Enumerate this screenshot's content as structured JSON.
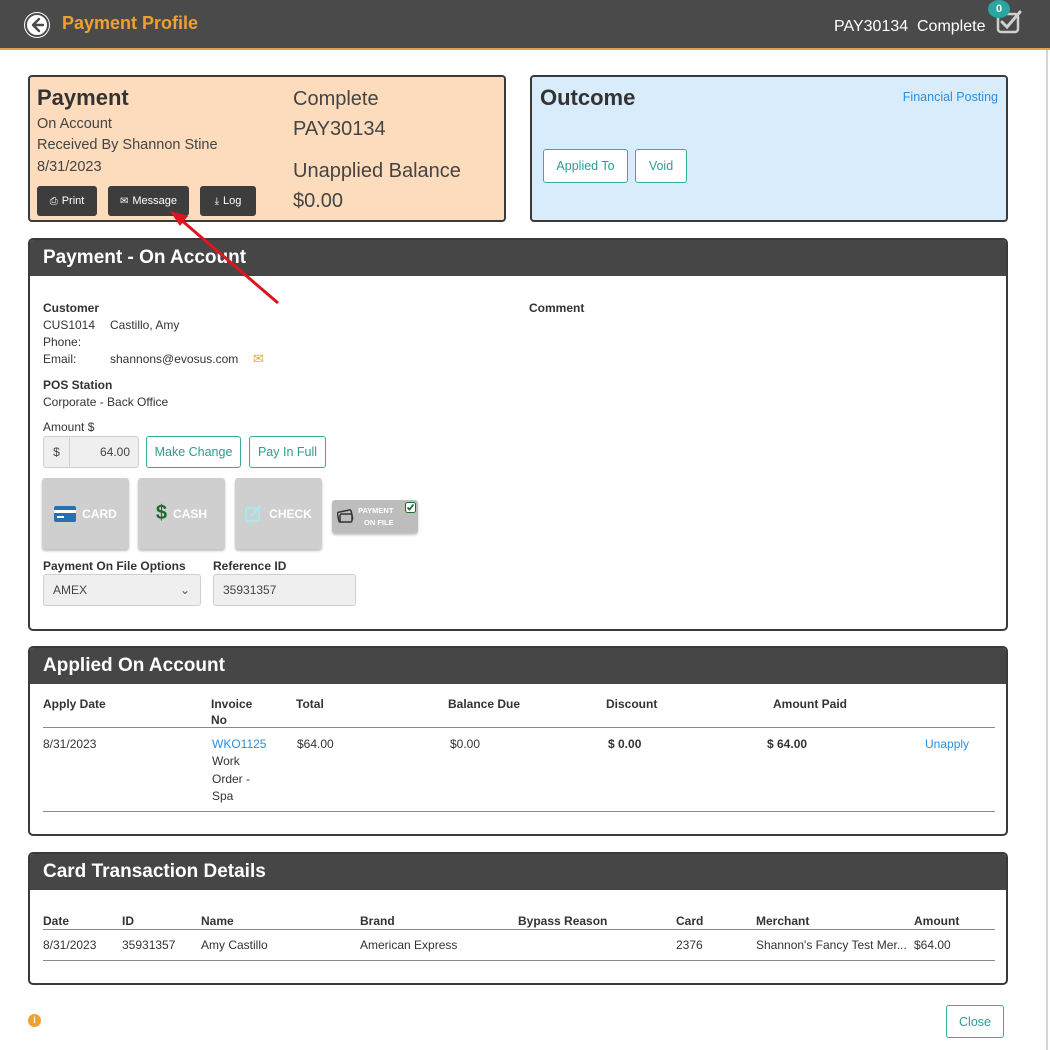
{
  "header": {
    "title": "Payment Profile",
    "payment_id": "PAY30134",
    "status": "Complete",
    "badge_count": "0"
  },
  "payment_card": {
    "title": "Payment",
    "type": "On Account",
    "received_by": "Received By Shannon Stine",
    "date": "8/31/2023",
    "status": "Complete",
    "id": "PAY30134",
    "unapplied_label": "Unapplied Balance",
    "unapplied_value": "$0.00",
    "buttons": {
      "print": "Print",
      "message": "Message",
      "log": "Log"
    }
  },
  "outcome_card": {
    "title": "Outcome",
    "link": "Financial Posting",
    "buttons": {
      "applied_to": "Applied To",
      "void": "Void"
    }
  },
  "payment_panel": {
    "title": "Payment - On Account",
    "customer_label": "Customer",
    "customer_id": "CUS1014",
    "customer_name": "Castillo, Amy",
    "phone_label": "Phone:",
    "email_label": "Email:",
    "email_value": "shannons@evosus.com",
    "comment_label": "Comment",
    "pos_label": "POS Station",
    "pos_value": "Corporate - Back Office",
    "amount_label": "Amount $",
    "currency_symbol": "$",
    "amount_value": "64.00",
    "make_change": "Make Change",
    "pay_in_full": "Pay In Full",
    "tenders": {
      "card": "CARD",
      "cash": "CASH",
      "check": "CHECK",
      "pof_line1": "PAYMENT",
      "pof_line2": "ON FILE"
    },
    "pof_options_label": "Payment On File Options",
    "pof_selected": "AMEX",
    "reference_label": "Reference ID",
    "reference_value": "35931357"
  },
  "applied_panel": {
    "title": "Applied On Account",
    "headers": {
      "apply_date": "Apply Date",
      "invoice_no_1": "Invoice",
      "invoice_no_2": "No",
      "total": "Total",
      "balance_due": "Balance Due",
      "discount": "Discount",
      "amount_paid": "Amount Paid"
    },
    "row": {
      "apply_date": "8/31/2023",
      "invoice": "WKO1125",
      "desc_1": "Work",
      "desc_2": "Order -",
      "desc_3": "Spa",
      "total": "$64.00",
      "balance_due": "$0.00",
      "discount": "$ 0.00",
      "amount_paid": "$ 64.00",
      "action": "Unapply"
    }
  },
  "card_panel": {
    "title": "Card Transaction Details",
    "headers": {
      "date": "Date",
      "id": "ID",
      "name": "Name",
      "brand": "Brand",
      "bypass": "Bypass Reason",
      "card": "Card",
      "merchant": "Merchant",
      "amount": "Amount"
    },
    "row": {
      "date": "8/31/2023",
      "id": "35931357",
      "name": "Amy Castillo",
      "brand": "American Express",
      "bypass": "",
      "card": "2376",
      "merchant": "Shannon's Fancy Test Mer...",
      "amount": "$64.00"
    }
  },
  "footer": {
    "close": "Close"
  },
  "colors": {
    "header_bg": "#4a4a4a",
    "title_orange": "#f0a030",
    "payment_card_bg": "#fcdcbd",
    "outcome_card_bg": "#d9ecfb",
    "teal_accent": "#2a9d92",
    "link_blue": "#2a8fe0",
    "annotation_red": "#e0141e"
  }
}
